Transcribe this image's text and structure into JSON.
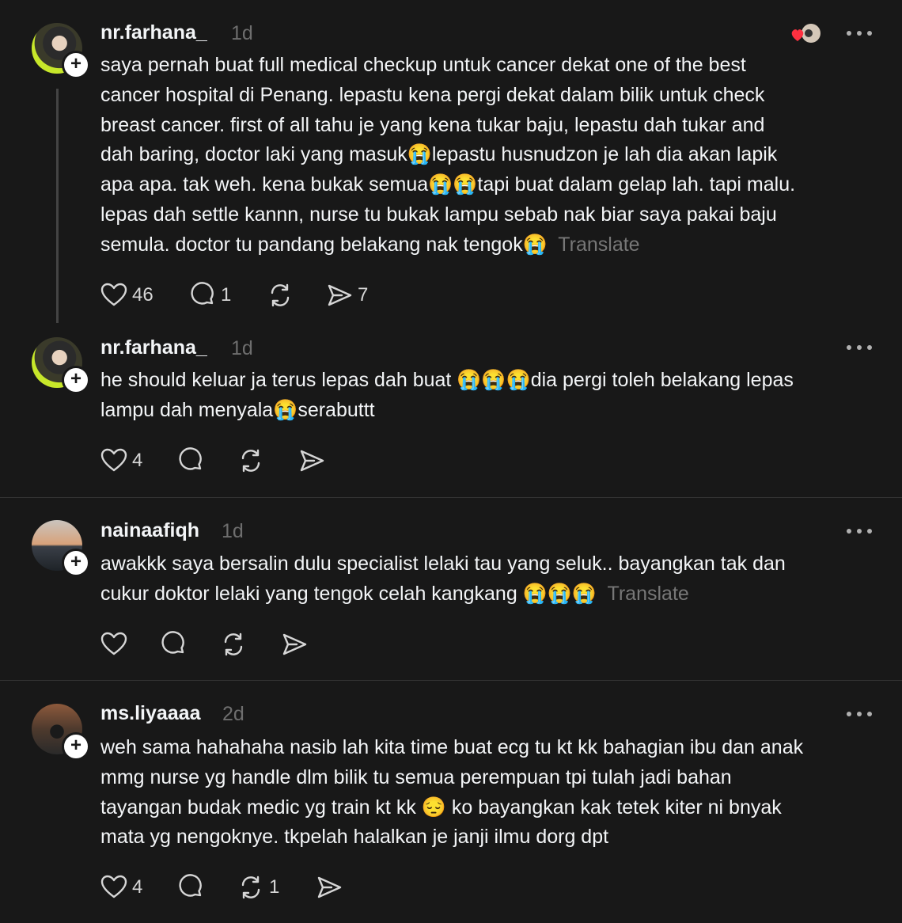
{
  "posts": [
    {
      "username": "nr.farhana_",
      "time": "1d",
      "text": "saya pernah buat full medical checkup untuk cancer dekat one of the best\ncancer hospital di Penang. lepastu kena pergi dekat dalam bilik untuk check\nbreast cancer. first of all tahu je yang kena tukar baju, lepastu dah tukar and\ndah baring, doctor laki yang masuk😭lepastu husnudzon je lah dia akan lapik\napa apa. tak weh. kena bukak semua😭😭tapi buat dalam gelap lah. tapi malu.\nlepas dah settle kannn, nurse tu bukak lampu sebab nak biar saya pakai baju\nsemula. doctor tu pandang belakang nak tengok😭",
      "translate": "Translate",
      "likes": "46",
      "replies": "1",
      "reposts": "",
      "shares": "7"
    },
    {
      "username": "nr.farhana_",
      "time": "1d",
      "text": "he should keluar ja terus lepas dah buat 😭😭😭dia pergi toleh belakang lepas\nlampu dah menyala😭serabuttt",
      "translate": "",
      "likes": "4",
      "replies": "",
      "reposts": "",
      "shares": ""
    },
    {
      "username": "nainaafiqh",
      "time": "1d",
      "text": "awakkk saya bersalin dulu specialist lelaki tau yang seluk.. bayangkan tak dan\ncukur doktor lelaki yang tengok celah kangkang 😭😭😭",
      "translate": "Translate",
      "likes": "",
      "replies": "",
      "reposts": "",
      "shares": ""
    },
    {
      "username": "ms.liyaaaa",
      "time": "2d",
      "text": "weh sama hahahaha nasib lah kita time buat ecg tu kt kk bahagian ibu dan anak\nmmg nurse yg handle dlm bilik tu semua perempuan tpi tulah jadi bahan\ntayangan budak medic yg train kt kk 😔 ko bayangkan kak tetek kiter ni bnyak\nmata yg nengoknye. tkpelah halalkan je janji ilmu dorg dpt",
      "translate": "",
      "likes": "4",
      "replies": "",
      "reposts": "1",
      "shares": ""
    }
  ],
  "icons": {
    "like": "heart-icon",
    "reply": "comment-icon",
    "repost": "repost-icon",
    "share": "send-icon",
    "more": "more-icon",
    "follow": "plus-icon"
  },
  "colors": {
    "background": "#181818",
    "text": "#f3f5f7",
    "muted": "#777777",
    "like_dot": "#ff3040"
  }
}
